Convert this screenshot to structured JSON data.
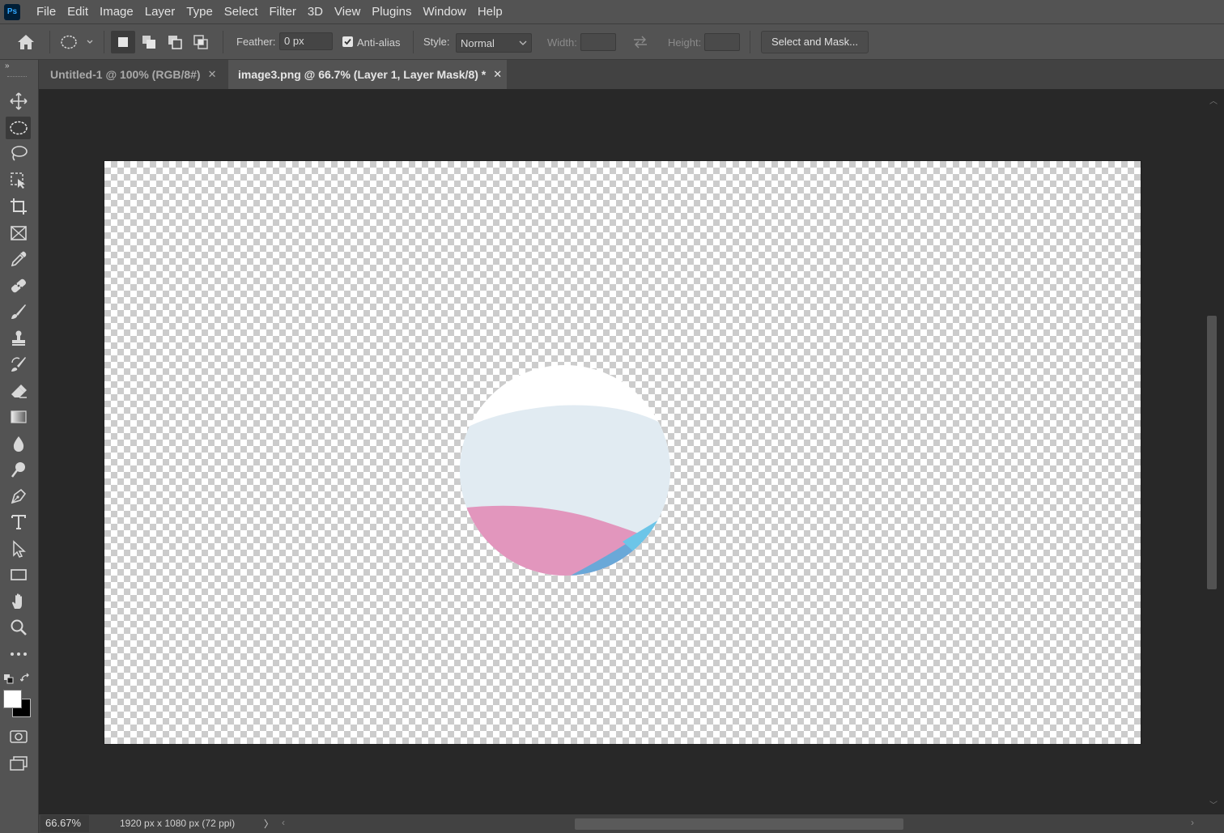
{
  "app": {
    "logo": "Ps"
  },
  "menu": [
    "File",
    "Edit",
    "Image",
    "Layer",
    "Type",
    "Select",
    "Filter",
    "3D",
    "View",
    "Plugins",
    "Window",
    "Help"
  ],
  "options": {
    "feather_label": "Feather:",
    "feather_value": "0 px",
    "antialias_label": "Anti-alias",
    "antialias_checked": true,
    "style_label": "Style:",
    "style_value": "Normal",
    "width_label": "Width:",
    "height_label": "Height:",
    "select_mask": "Select and Mask..."
  },
  "tabs": [
    {
      "title": "Untitled-1 @ 100% (RGB/8#)",
      "active": false
    },
    {
      "title": "image3.png @ 66.7% (Layer 1, Layer Mask/8) *",
      "active": true
    }
  ],
  "status": {
    "zoom": "66.67%",
    "doc_info": "1920 px x 1080 px (72 ppi)"
  },
  "colors": {
    "foreground": "#ffffff",
    "background": "#000000",
    "circle_top": "#ffffff",
    "circle_mid": "#e1ebf2",
    "circle_pink": "#e296bd",
    "circle_blue": "#6aa8d8",
    "circle_cyan": "#6cc5e8"
  },
  "tools": [
    "move-tool",
    "elliptical-marquee-tool",
    "lasso-tool",
    "object-selection-tool",
    "crop-tool",
    "frame-tool",
    "eyedropper-tool",
    "healing-brush-tool",
    "brush-tool",
    "clone-stamp-tool",
    "history-brush-tool",
    "eraser-tool",
    "gradient-tool",
    "blur-tool",
    "dodge-tool",
    "pen-tool",
    "type-tool",
    "path-selection-tool",
    "rectangle-tool",
    "hand-tool",
    "zoom-tool",
    "edit-toolbar"
  ]
}
